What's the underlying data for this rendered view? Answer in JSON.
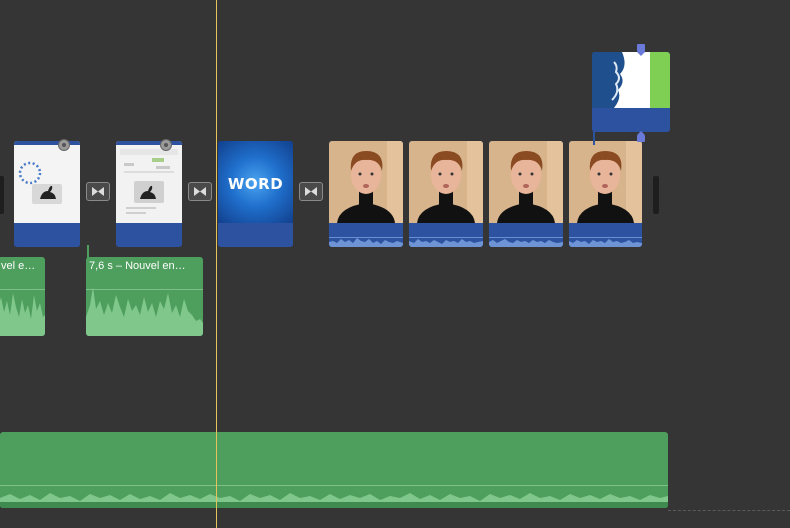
{
  "timeline": {
    "background_color": "#353535",
    "playhead_color": "#e3c35a",
    "video_track": {
      "clips": [
        {
          "kind": "document-screenshot",
          "icon": "rabbit-icon",
          "has_badge": true
        },
        {
          "kind": "document-screenshot",
          "icon": "rabbit-icon",
          "has_badge": true
        },
        {
          "kind": "title-card",
          "text": "WORD"
        },
        {
          "kind": "video",
          "subject": "man-in-black-turtleneck"
        },
        {
          "kind": "video",
          "subject": "man-in-black-turtleneck"
        },
        {
          "kind": "video",
          "subject": "man-in-black-turtleneck"
        },
        {
          "kind": "video",
          "subject": "man-in-black-turtleneck"
        }
      ],
      "transitions": [
        "cross-dissolve-icon",
        "cross-dissolve-icon",
        "cross-dissolve-icon"
      ]
    },
    "cutaway_clip": {
      "kind": "overlay",
      "colors": [
        "#1f4f8c",
        "#ffffff",
        "#7fcf55"
      ]
    },
    "audio_clips": [
      {
        "label": "vel e…"
      },
      {
        "label": "7,6 s – Nouvel en…"
      }
    ],
    "music_track": {
      "color": "#4e9e5e"
    }
  }
}
